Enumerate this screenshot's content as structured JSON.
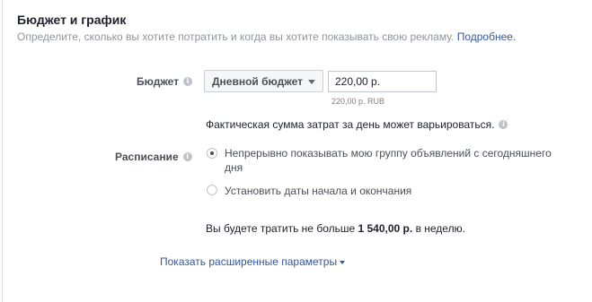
{
  "section": {
    "title": "Бюджет и график",
    "description": "Определите, сколько вы хотите потратить и когда вы хотите показывать свою рекламу.",
    "more_link": "Подробнее."
  },
  "budget": {
    "label": "Бюджет",
    "type_selected": "Дневной бюджет",
    "amount": "220,00 р.",
    "amount_hint": "220,00 р. RUB",
    "actual_note": "Фактическая сумма затрат за день может варьироваться."
  },
  "schedule": {
    "label": "Расписание",
    "options": [
      {
        "label": "Непрерывно показывать мою группу объявлений с сегодняшнего дня",
        "checked": true
      },
      {
        "label": "Установить даты начала и окончания",
        "checked": false
      }
    ]
  },
  "spend": {
    "prefix": "Вы будете тратить не больше",
    "amount": "1 540,00 р.",
    "suffix": "в неделю."
  },
  "advanced": {
    "link_label": "Показать расширенные параметры"
  },
  "info_glyph": "i"
}
